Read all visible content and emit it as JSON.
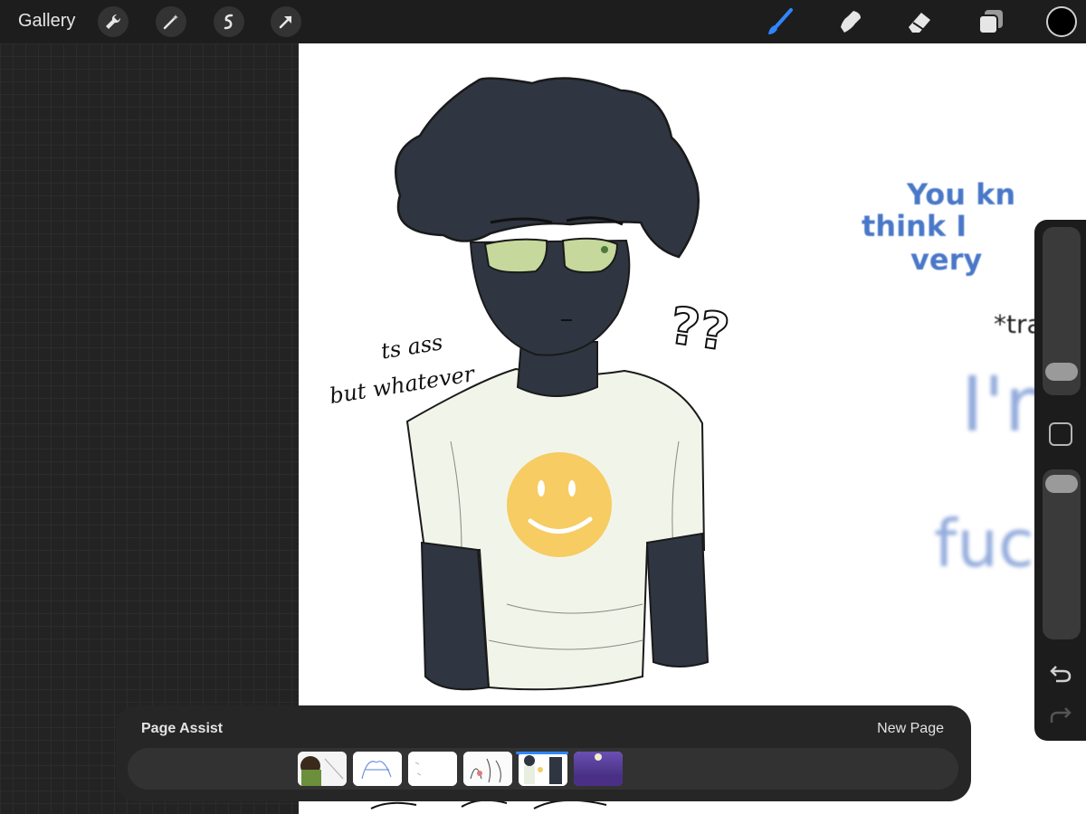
{
  "toolbar": {
    "gallery_label": "Gallery",
    "left_tools": [
      "wrench-icon",
      "magic-wand-icon",
      "selection-icon",
      "transform-arrow-icon"
    ],
    "right_tools": [
      "brush-icon",
      "smudge-icon",
      "eraser-icon",
      "layers-icon"
    ],
    "active_tool": "brush",
    "accent_color": "#2f86ff",
    "current_color": "#000000"
  },
  "canvas": {
    "handwritten_lines": [
      "ts ass",
      "but whatever"
    ],
    "question_marks": "??",
    "overlay_text": [
      "You kn",
      "think I",
      "very",
      "*tran",
      "I'm g",
      "fucking"
    ],
    "overlay_color": "#4a78c8"
  },
  "sidebar": {
    "brush_size_level": 0.82,
    "opacity_level": 1.0,
    "icons": [
      "modify-square-icon",
      "undo-icon",
      "redo-icon"
    ]
  },
  "page_assist": {
    "title": "Page Assist",
    "new_page_label": "New Page",
    "pages": [
      "page-1",
      "page-2",
      "page-3",
      "page-4",
      "page-5",
      "page-6"
    ],
    "active_page_index": 4
  }
}
